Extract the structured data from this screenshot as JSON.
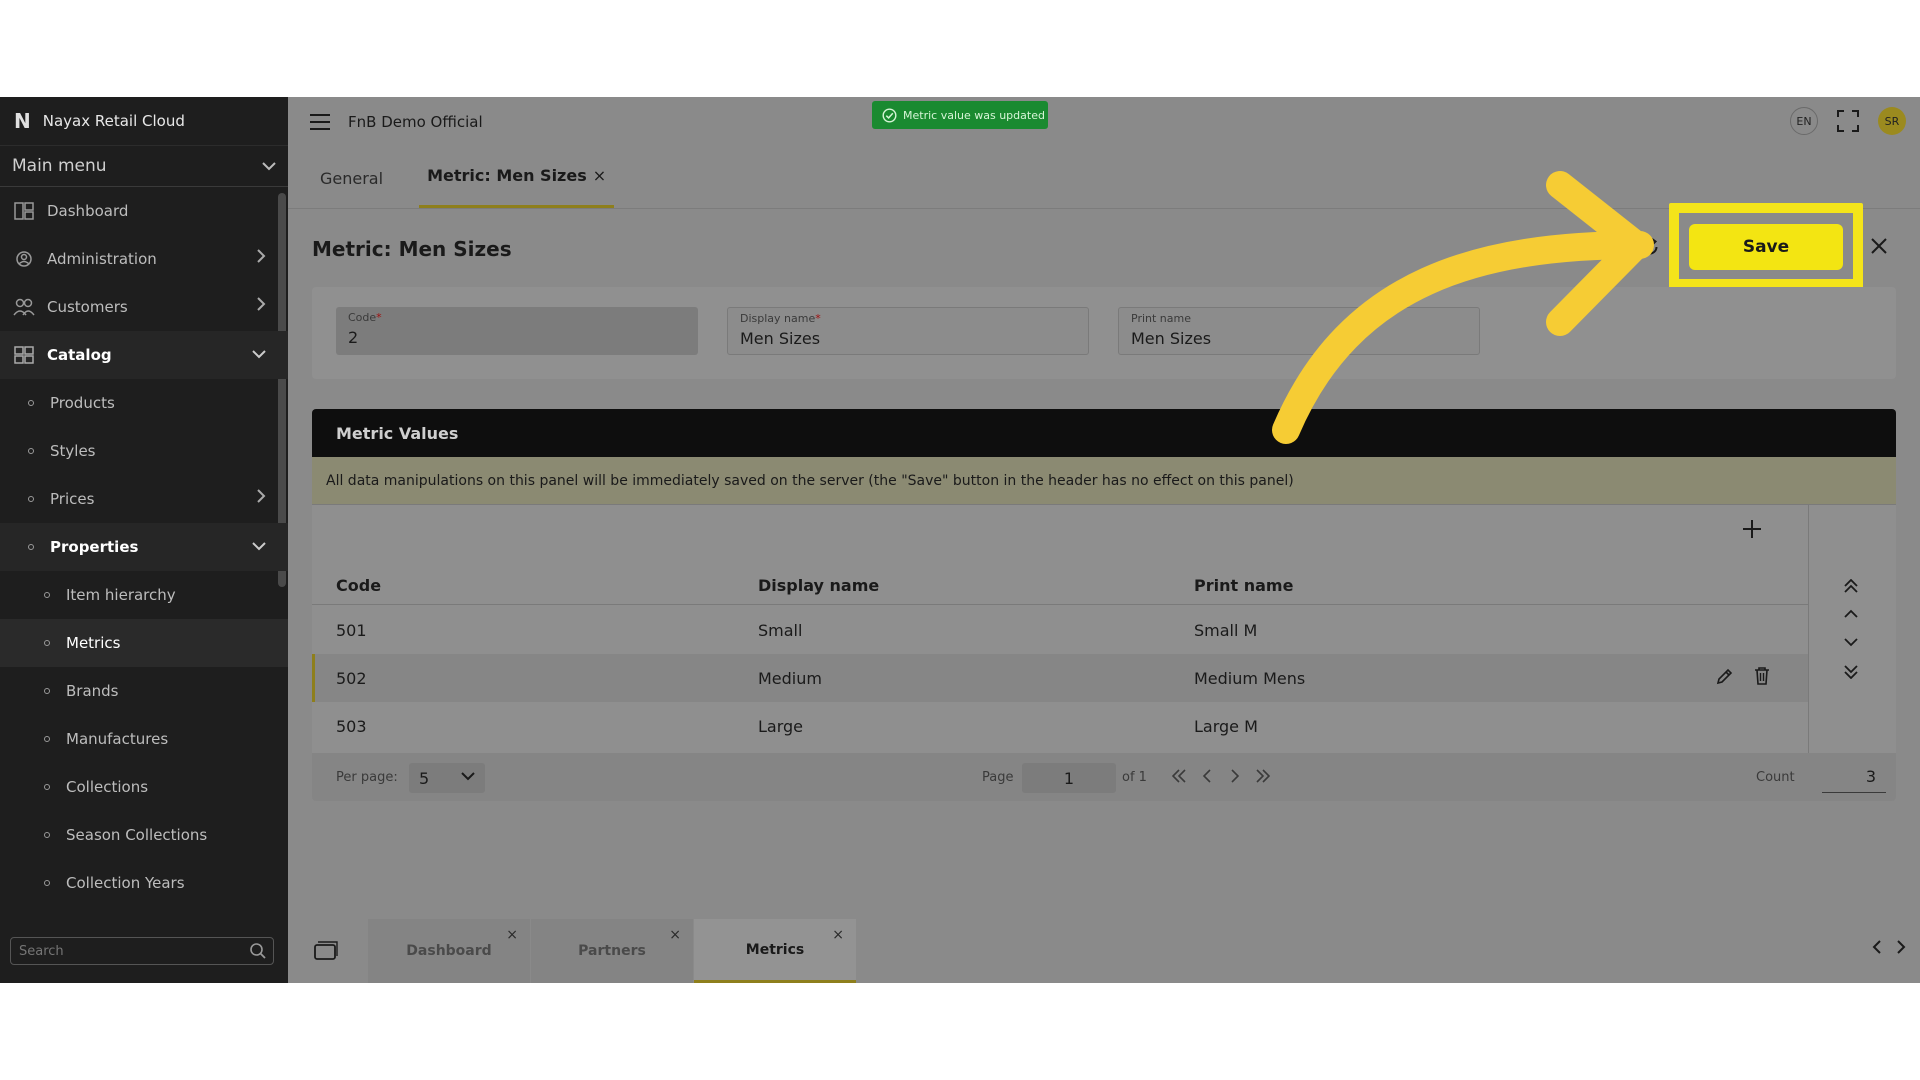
{
  "sidebar": {
    "brand": "Nayax Retail Cloud",
    "brand_logo": "N",
    "main_menu": "Main menu",
    "items": [
      {
        "label": "Dashboard",
        "icon": "dashboard-icon"
      },
      {
        "label": "Administration",
        "icon": "gear-user-icon"
      },
      {
        "label": "Customers",
        "icon": "customers-icon"
      },
      {
        "label": "Catalog",
        "icon": "catalog-icon"
      },
      {
        "label": "Products"
      },
      {
        "label": "Styles"
      },
      {
        "label": "Prices"
      },
      {
        "label": "Properties"
      },
      {
        "label": "Item hierarchy"
      },
      {
        "label": "Metrics"
      },
      {
        "label": "Brands"
      },
      {
        "label": "Manufactures"
      },
      {
        "label": "Collections"
      },
      {
        "label": "Season Collections"
      },
      {
        "label": "Collection Years"
      }
    ],
    "search_placeholder": "Search"
  },
  "topbar": {
    "org": "FnB Demo Official",
    "toast": "Metric value was updated",
    "lang": "EN",
    "avatar": "SR"
  },
  "tabs": [
    {
      "label": "General"
    },
    {
      "label": "Metric: Men Sizes",
      "close": "×"
    }
  ],
  "page": {
    "title": "Metric: Men Sizes",
    "save_label": "Save",
    "fields": [
      {
        "label": "Code",
        "required": "*",
        "value": "2"
      },
      {
        "label": "Display name",
        "required": "*",
        "value": "Men Sizes"
      },
      {
        "label": "Print name",
        "required": "",
        "value": "Men Sizes"
      }
    ]
  },
  "panel": {
    "title": "Metric Values",
    "notice": "All data manipulations on this panel will be immediately saved on the server (the \"Save\" button in the header has no effect on this panel)",
    "columns": [
      "Code",
      "Display name",
      "Print name"
    ],
    "rows": [
      [
        "501",
        "Small",
        "Small M"
      ],
      [
        "502",
        "Medium",
        "Medium Mens"
      ],
      [
        "503",
        "Large",
        "Large M"
      ]
    ],
    "per_page_label": "Per page:",
    "per_page": "5",
    "page_label": "Page",
    "page": "1",
    "of_label": "of 1",
    "count_label": "Count",
    "count": "3"
  },
  "bottom_tabs": [
    {
      "label": "Dashboard",
      "close": "×"
    },
    {
      "label": "Partners",
      "close": "×"
    },
    {
      "label": "Metrics",
      "close": "×"
    }
  ],
  "colors": {
    "accent": "#f3e512",
    "highlight_box": "#f4e41a",
    "arrow": "#f6cc34",
    "toast": "#1a8a30",
    "sidebar": "#1e1e1e"
  }
}
